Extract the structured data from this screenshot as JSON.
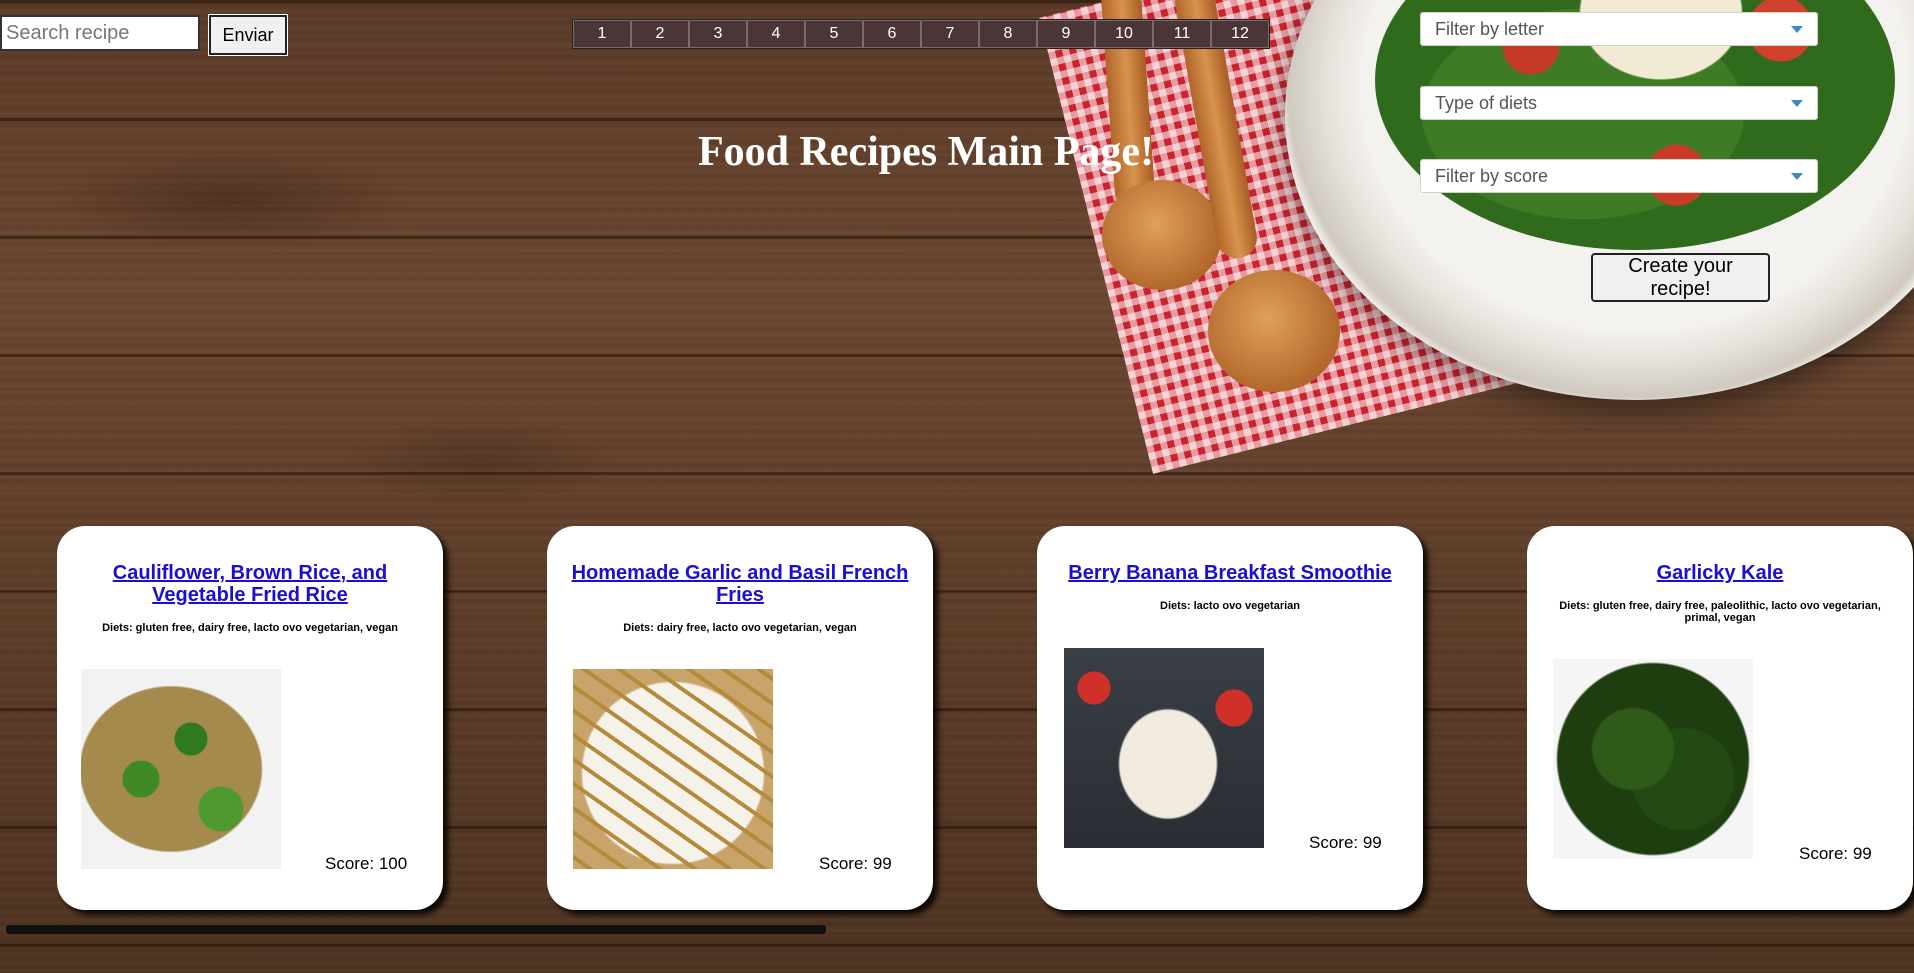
{
  "header": {
    "search_placeholder": "Search recipe",
    "search_button": "Enviar",
    "pages": [
      "1",
      "2",
      "3",
      "4",
      "5",
      "6",
      "7",
      "8",
      "9",
      "10",
      "11",
      "12"
    ],
    "title": "Food Recipes Main Page!"
  },
  "filters": {
    "letter": "Filter by letter",
    "diets": "Type of diets",
    "score": "Filter by score",
    "create_button": "Create your recipe!",
    "caret_color": "#3a8bc4"
  },
  "recipes": [
    {
      "title": "Cauliflower, Brown Rice, and Vegetable Fried Rice",
      "diets": "Diets: gluten free, dairy free, lacto ovo vegetarian, vegan",
      "score": "Score: 100",
      "image": "fried-rice-photo"
    },
    {
      "title": "Homemade Garlic and Basil French Fries",
      "diets": "Diets: dairy free, lacto ovo vegetarian, vegan",
      "score": "Score: 99",
      "image": "french-fries-photo"
    },
    {
      "title": "Berry Banana Breakfast Smoothie",
      "diets": "Diets: lacto ovo vegetarian",
      "score": "Score: 99",
      "image": "smoothie-photo"
    },
    {
      "title": "Garlicky Kale",
      "diets": "Diets: gluten free, dairy free, paleolithic, lacto ovo vegetarian, primal, vegan",
      "score": "Score: 99",
      "image": "kale-photo"
    }
  ],
  "colors": {
    "link": "#1a0dd6",
    "page_button": "#4a3636"
  }
}
